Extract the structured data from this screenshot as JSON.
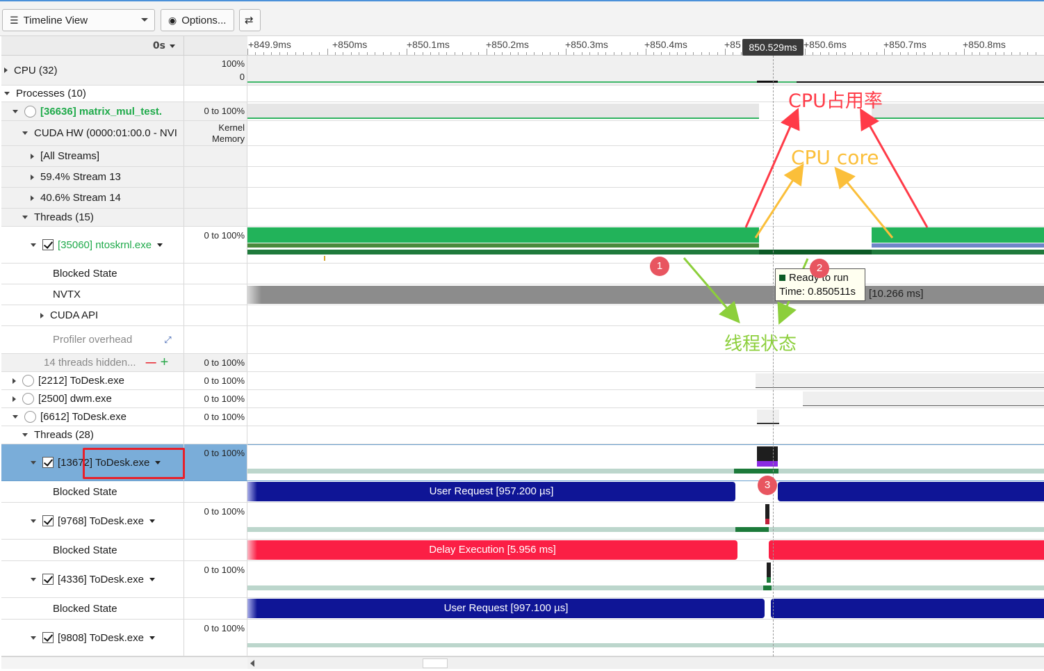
{
  "toolbar": {
    "view_select": "Timeline View",
    "options_label": "Options...",
    "swap_label": "⇄"
  },
  "tree_header": {
    "time_offset": "0s"
  },
  "ruler": {
    "ticks": [
      "+849.9ms",
      "+850ms",
      "+850.1ms",
      "+850.2ms",
      "+850.3ms",
      "+850.4ms",
      "+85",
      "+850.6ms",
      "+850.7ms",
      "+850.8ms"
    ],
    "cursor_time": "850.529ms"
  },
  "rows": {
    "cpu": {
      "label": "CPU (32)",
      "scale_top": "100%",
      "scale_bottom": "0"
    },
    "processes": {
      "label": "Processes (10)"
    },
    "matrix": {
      "label": "[36636] matrix_mul_test.",
      "scale": "0 to 100%"
    },
    "cuda_hw": {
      "label": "CUDA HW (0000:01:00.0 - NVI",
      "scale_top": "Kernel",
      "scale_bottom": "Memory"
    },
    "all_streams": {
      "label": "[All Streams]"
    },
    "stream13": {
      "label": "59.4% Stream 13"
    },
    "stream14": {
      "label": "40.6% Stream 14"
    },
    "threads15": {
      "label": "Threads (15)"
    },
    "ntoskrnl": {
      "label": "[35060] ntoskrnl.exe",
      "scale": "0 to 100%"
    },
    "blocked1": {
      "label": "Blocked State"
    },
    "nvtx": {
      "label": "NVTX",
      "bar_text": "[10.266 ms]"
    },
    "cuda_api": {
      "label": "CUDA API"
    },
    "profiler": {
      "label": "Profiler overhead"
    },
    "hidden": {
      "label": "14 threads hidden...",
      "minus": "—",
      "plus": "+",
      "scale": "0 to 100%"
    },
    "todesk2212": {
      "label": "[2212] ToDesk.exe",
      "scale": "0 to 100%"
    },
    "dwm": {
      "label": "[2500] dwm.exe",
      "scale": "0 to 100%"
    },
    "todesk6612": {
      "label": "[6612] ToDesk.exe",
      "scale": "0 to 100%"
    },
    "threads28": {
      "label": "Threads (28)"
    },
    "t13672": {
      "label": "[13672] ToDesk.exe",
      "scale": "0 to 100%"
    },
    "blocked2": {
      "label": "Blocked State",
      "bar_text": "User Request [957.200 µs]"
    },
    "t9768": {
      "label": "[9768] ToDesk.exe",
      "scale": "0 to 100%"
    },
    "blocked3": {
      "label": "Blocked State",
      "bar_text": "Delay Execution [5.956 ms]"
    },
    "t4336": {
      "label": "[4336] ToDesk.exe",
      "scale": "0 to 100%"
    },
    "blocked4": {
      "label": "Blocked State",
      "bar_text": "User Request [997.100 µs]"
    },
    "t9808": {
      "label": "[9808] ToDesk.exe",
      "scale": "0 to 100%"
    }
  },
  "tooltip": {
    "line1": "Ready to run",
    "line2": "Time: 0.850511s"
  },
  "annotations": {
    "cpu_usage": "CPU占用率",
    "cpu_core": "CPU core",
    "thread_state": "线程状态",
    "n1": "1",
    "n2": "2",
    "n3": "3"
  },
  "colors": {
    "green": "#22b35a",
    "dark_green": "#0f6b2c",
    "navy": "#0f1596",
    "crimson": "#fb1f45",
    "accent": "#4a90d9"
  }
}
